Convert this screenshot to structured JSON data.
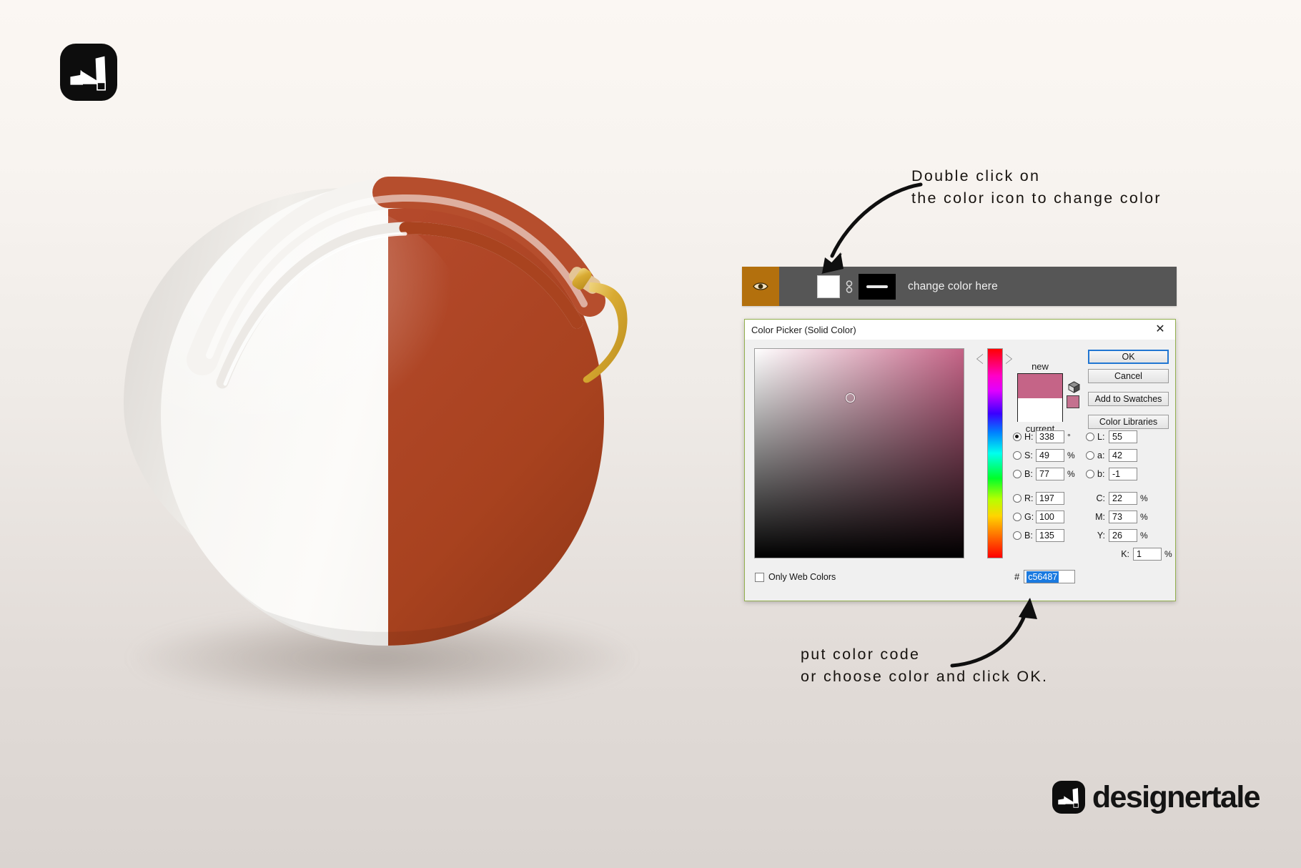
{
  "brand": {
    "name": "designertale",
    "logo_icon": "designertale-mark-icon"
  },
  "annotations": {
    "top": {
      "line1": "Double click on",
      "line2": "the color icon to change color",
      "arrow_icon": "curved-arrow-down-icon"
    },
    "bottom": {
      "line1": "put color code",
      "line2": "or choose color and click OK.",
      "arrow_icon": "curved-arrow-up-icon"
    }
  },
  "layer_bar": {
    "eye_icon": "eye-visibility-icon",
    "layer_thumbnail_icon": "solid-color-thumbnail-icon",
    "link_icon": "link-mask-icon",
    "mask_thumbnail_icon": "layer-mask-thumbnail-icon",
    "layer_name": "change color here"
  },
  "picker": {
    "title": "Color Picker (Solid Color)",
    "close_icon": "close-icon",
    "swatch": {
      "new_label": "new",
      "current_label": "current",
      "new_color": "#c56487",
      "current_color": "#ffffff",
      "out_of_gamut_icon": "cube-gamut-warning-icon",
      "out_of_gamut_color": "#c4718f"
    },
    "buttons": {
      "ok": "OK",
      "cancel": "Cancel",
      "add_to_swatches": "Add to Swatches",
      "color_libraries": "Color Libraries"
    },
    "fields": {
      "hsb": [
        {
          "label": "H:",
          "value": "338",
          "unit": "°",
          "selected": true
        },
        {
          "label": "S:",
          "value": "49",
          "unit": "%",
          "selected": false
        },
        {
          "label": "B:",
          "value": "77",
          "unit": "%",
          "selected": false
        }
      ],
      "rgb": [
        {
          "label": "R:",
          "value": "197",
          "unit": "",
          "selected": false
        },
        {
          "label": "G:",
          "value": "100",
          "unit": "",
          "selected": false
        },
        {
          "label": "B:",
          "value": "135",
          "unit": "",
          "selected": false
        }
      ],
      "lab": [
        {
          "label": "L:",
          "value": "55",
          "unit": "",
          "selected": false
        },
        {
          "label": "a:",
          "value": "42",
          "unit": "",
          "selected": false
        },
        {
          "label": "b:",
          "value": "-1",
          "unit": "",
          "selected": false
        }
      ],
      "cmyk": [
        {
          "label": "C:",
          "value": "22",
          "unit": "%"
        },
        {
          "label": "M:",
          "value": "73",
          "unit": "%"
        },
        {
          "label": "Y:",
          "value": "26",
          "unit": "%"
        },
        {
          "label": "K:",
          "value": "1",
          "unit": "%"
        }
      ]
    },
    "only_web_colors": {
      "label": "Only Web Colors",
      "checked": false
    },
    "hex": {
      "prefix": "#",
      "value": "c56487",
      "selected": true
    },
    "sb_cursor": {
      "x_pct": 44,
      "y_pct": 22
    },
    "hue_marker_pct": 8
  },
  "product": {
    "name": "round-zipper-pouch-mockup",
    "left_half_color": "#f4f2ef",
    "right_half_color": "#b44a2c",
    "zipper_color": "#d6a93c"
  },
  "colors": {
    "background_top": "#fbf7f3",
    "background_bottom": "#dad4d0",
    "layer_bar_bg": "#565656",
    "eye_cell_bg": "#b3700d",
    "picker_bg": "#f0f0f0",
    "picker_border": "#93b04e",
    "ok_border": "#2176d2",
    "hex_highlight": "#1a7ae0"
  }
}
